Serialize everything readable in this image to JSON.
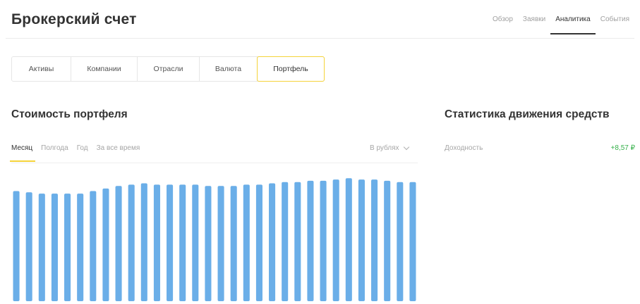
{
  "header": {
    "title": "Брокерский счет",
    "nav": [
      {
        "label": "Обзор",
        "active": false
      },
      {
        "label": "Заявки",
        "active": false
      },
      {
        "label": "Аналитика",
        "active": true
      },
      {
        "label": "События",
        "active": false
      }
    ]
  },
  "segment_tabs": [
    {
      "label": "Активы",
      "active": false
    },
    {
      "label": "Компании",
      "active": false
    },
    {
      "label": "Отрасли",
      "active": false
    },
    {
      "label": "Валюта",
      "active": false
    },
    {
      "label": "Портфель",
      "active": true
    }
  ],
  "portfolio": {
    "title": "Стоимость портфеля",
    "periods": [
      {
        "label": "Месяц",
        "active": true
      },
      {
        "label": "Полгода",
        "active": false
      },
      {
        "label": "Год",
        "active": false
      },
      {
        "label": "За все время",
        "active": false
      }
    ],
    "currency_select": "В рублях"
  },
  "stats": {
    "title": "Статистика движения средств",
    "rows": [
      {
        "label": "Доходность",
        "value": "+8,57 ₽"
      }
    ]
  },
  "colors": {
    "accent_yellow": "#f5d33a",
    "bar_blue": "#6aaee8",
    "positive_green": "#35b04a"
  },
  "chart_data": {
    "type": "bar",
    "title": "",
    "xlabel": "",
    "ylabel": "",
    "ylim": [
      0,
      100
    ],
    "grid": false,
    "categories": [],
    "values": [
      86,
      85,
      84,
      84,
      84,
      84,
      86,
      88,
      90,
      91,
      92,
      91,
      91,
      91,
      91,
      90,
      90,
      90,
      91,
      91,
      92,
      93,
      93,
      94,
      94,
      95,
      96,
      95,
      95,
      94,
      93,
      93
    ]
  }
}
